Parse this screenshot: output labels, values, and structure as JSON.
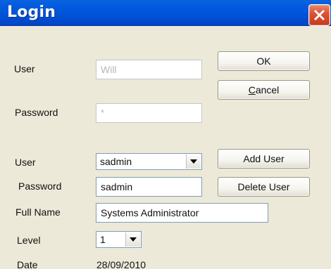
{
  "window": {
    "title": "Login",
    "colors": {
      "titlebar": "#0055d8",
      "background": "#ece9d8",
      "close_button": "#dd5433",
      "input_border": "#7f9db9"
    },
    "close_icon": "close-icon"
  },
  "login": {
    "user_label": "User",
    "user_value": "Will",
    "password_label": "Password",
    "password_value": "*"
  },
  "buttons": {
    "ok": "OK",
    "cancel": "Cancel",
    "add_user": "Add User",
    "delete_user": "Delete User"
  },
  "user_admin": {
    "user_label": "User",
    "user_selected": "sadmin",
    "password_label": "Password",
    "password_value": "sadmin",
    "full_name_label": "Full Name",
    "full_name_value": "Systems Administrator",
    "level_label": "Level",
    "level_selected": "1",
    "date_label": "Date",
    "date_value": "28/09/2010"
  }
}
